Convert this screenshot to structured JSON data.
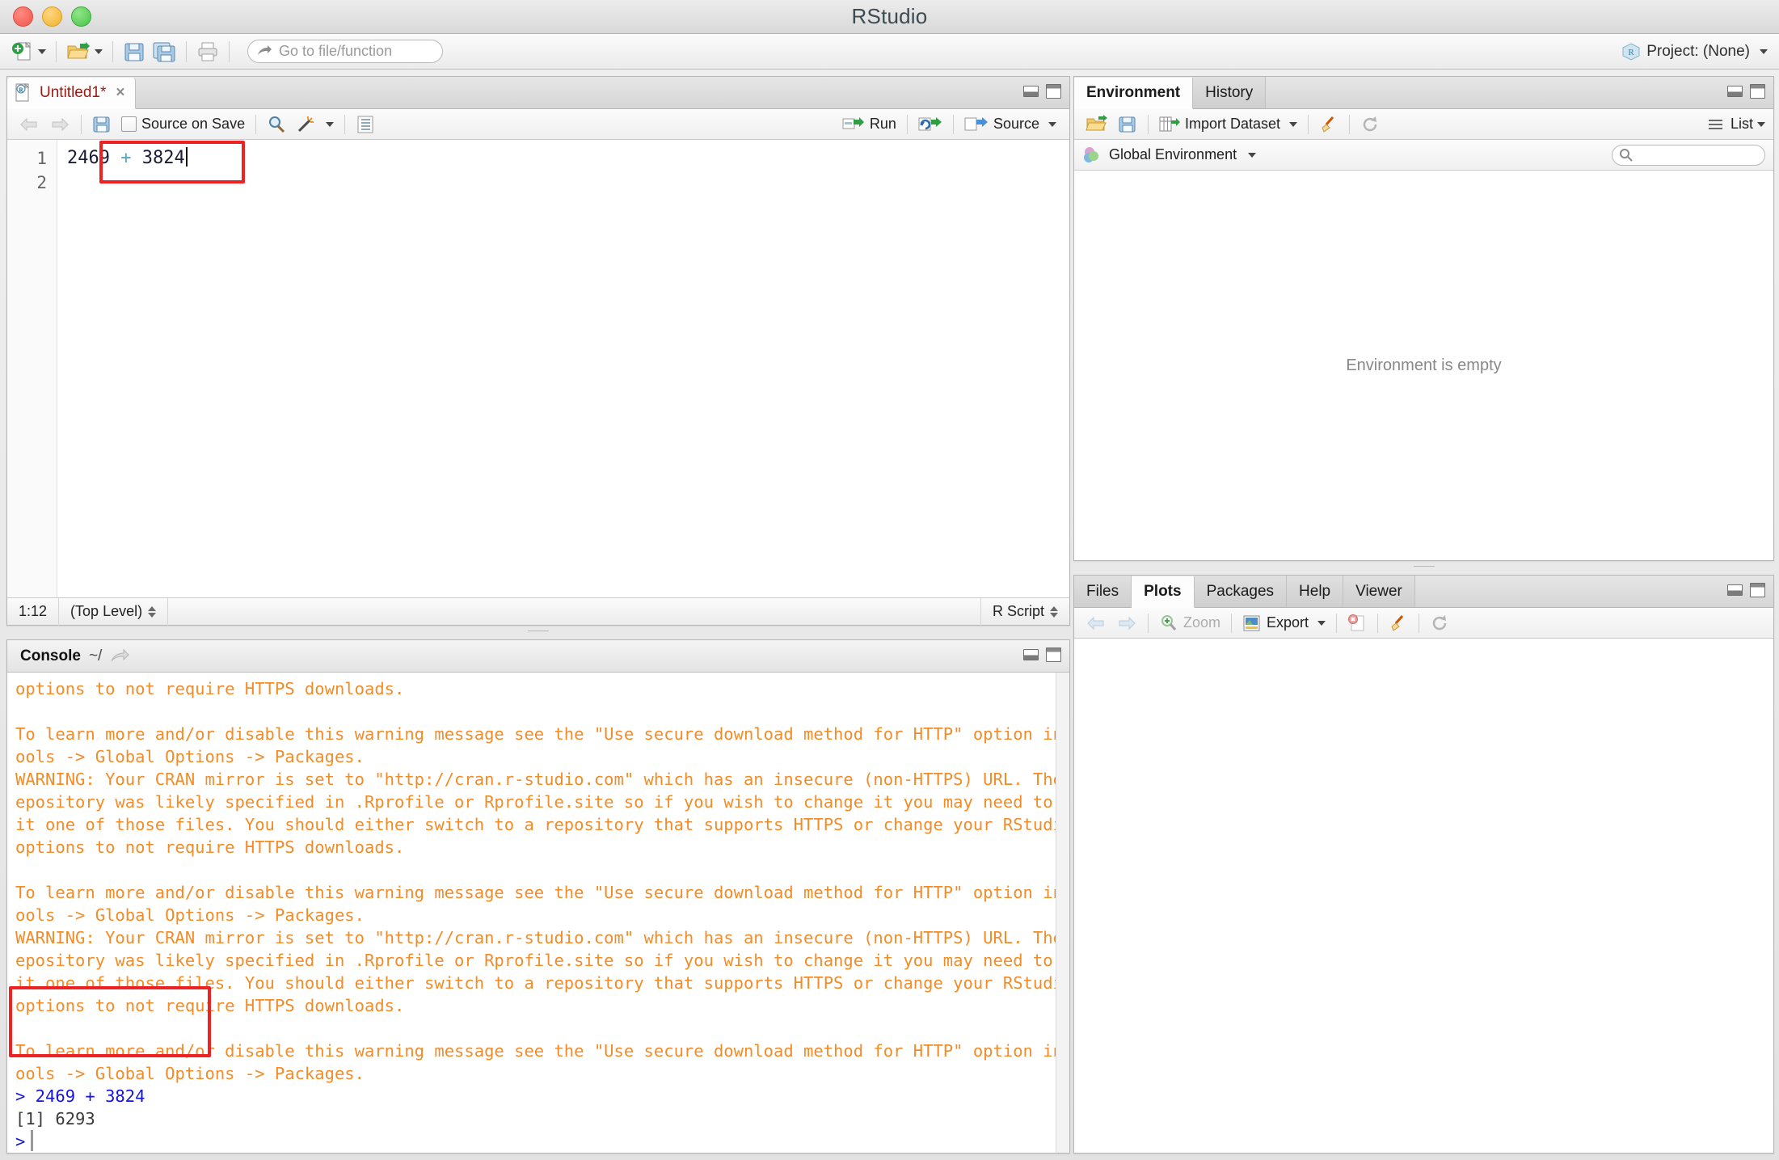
{
  "window": {
    "title": "RStudio",
    "traffic_lights": [
      "close",
      "minimize",
      "zoom"
    ]
  },
  "toolbar": {
    "new_file_label": "new-file",
    "open_file_label": "open-file",
    "save_label": "save",
    "save_all_label": "save-all",
    "print_label": "print",
    "goto_placeholder": "Go to file/function",
    "project_label": "Project: (None)"
  },
  "source_panel": {
    "tab": {
      "title": "Untitled1*",
      "close": "×"
    },
    "toolbar": {
      "back": "⇦",
      "forward": "⇨",
      "save": "save",
      "source_on_save_label": "Source on Save",
      "source_on_save_checked": false,
      "find": "find",
      "code_tools": "code-tools",
      "compile_report": "compile-report",
      "run_label": "Run",
      "rerun_label": "re-run",
      "source_label": "Source"
    },
    "editor": {
      "lines": [
        {
          "number": "1",
          "num1": "2469",
          "op": "+",
          "num2": "3824"
        },
        {
          "number": "2",
          "num1": "",
          "op": "",
          "num2": ""
        }
      ],
      "highlight": true
    },
    "status": {
      "cursor": "1:12",
      "scope": "(Top Level)",
      "file_type": "R Script"
    }
  },
  "console_panel": {
    "header": {
      "title": "Console",
      "path": "~/"
    },
    "lines": [
      {
        "text": "options to not require HTTPS downloads.",
        "kind": "warn"
      },
      {
        "text": "",
        "kind": "warn"
      },
      {
        "text": "To learn more and/or disable this warning message see the \"Use secure download method for HTTP\" option in T",
        "kind": "warn"
      },
      {
        "text": "ools -> Global Options -> Packages.",
        "kind": "warn"
      },
      {
        "text": "WARNING: Your CRAN mirror is set to \"http://cran.r-studio.com\" which has an insecure (non-HTTPS) URL. The r",
        "kind": "warn"
      },
      {
        "text": "epository was likely specified in .Rprofile or Rprofile.site so if you wish to change it you may need to ed",
        "kind": "warn"
      },
      {
        "text": "it one of those files. You should either switch to a repository that supports HTTPS or change your RStudio",
        "kind": "warn"
      },
      {
        "text": "options to not require HTTPS downloads.",
        "kind": "warn"
      },
      {
        "text": "",
        "kind": "warn"
      },
      {
        "text": "To learn more and/or disable this warning message see the \"Use secure download method for HTTP\" option in T",
        "kind": "warn"
      },
      {
        "text": "ools -> Global Options -> Packages.",
        "kind": "warn"
      },
      {
        "text": "WARNING: Your CRAN mirror is set to \"http://cran.r-studio.com\" which has an insecure (non-HTTPS) URL. The r",
        "kind": "warn"
      },
      {
        "text": "epository was likely specified in .Rprofile or Rprofile.site so if you wish to change it you may need to ed",
        "kind": "warn"
      },
      {
        "text": "it one of those files. You should either switch to a repository that supports HTTPS or change your RStudio",
        "kind": "warn"
      },
      {
        "text": "options to not require HTTPS downloads.",
        "kind": "warn"
      },
      {
        "text": "",
        "kind": "warn"
      },
      {
        "text": "To learn more and/or disable this warning message see the \"Use secure download method for HTTP\" option in T",
        "kind": "warn"
      },
      {
        "text": "ools -> Global Options -> Packages.",
        "kind": "warn"
      },
      {
        "text": "> 2469 + 3824",
        "kind": "cmd"
      },
      {
        "text": "[1] 6293",
        "kind": "out"
      },
      {
        "text": ">",
        "kind": "prompt"
      }
    ],
    "highlight": true
  },
  "environment_panel": {
    "tabs": [
      {
        "label": "Environment",
        "active": true
      },
      {
        "label": "History",
        "active": false
      }
    ],
    "toolbar": {
      "load_label": "load-workspace",
      "save_label": "save-workspace",
      "import_label": "Import Dataset",
      "clear_label": "clear-objects",
      "refresh_label": "refresh",
      "view_label": "List"
    },
    "scope_selector": "Global Environment",
    "search_placeholder": "",
    "empty_message": "Environment is empty"
  },
  "files_panel": {
    "tabs": [
      {
        "label": "Files",
        "active": false
      },
      {
        "label": "Plots",
        "active": true
      },
      {
        "label": "Packages",
        "active": false
      },
      {
        "label": "Help",
        "active": false
      },
      {
        "label": "Viewer",
        "active": false
      }
    ],
    "toolbar": {
      "back": "back",
      "forward": "forward",
      "zoom_label": "Zoom",
      "export_label": "Export",
      "remove_label": "remove-plot",
      "clear_label": "clear-plots",
      "refresh_label": "refresh"
    }
  },
  "colors": {
    "console_warning": "#f28c28",
    "console_command": "#1414dc",
    "highlight_box": "#ee2222",
    "tab_modified": "#9b1a14"
  }
}
